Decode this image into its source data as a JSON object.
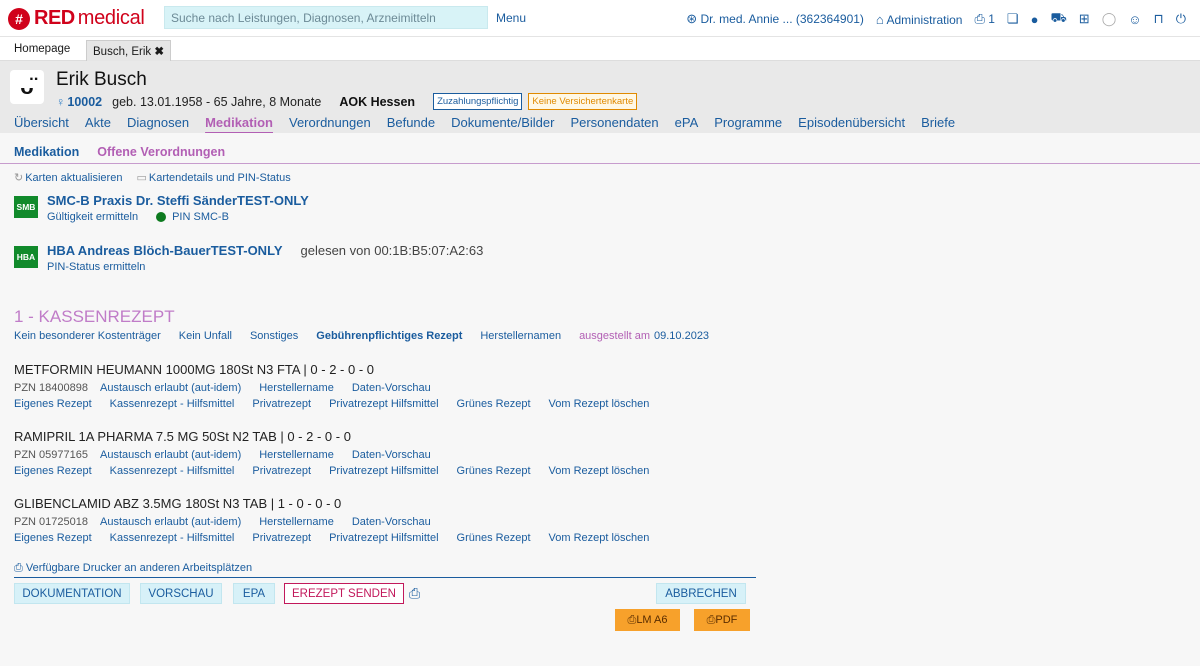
{
  "app": {
    "logo_red": "RED",
    "logo_medical": "medical",
    "logo_badge": "#",
    "search_placeholder": "Suche nach Leistungen, Diagnosen, Arzneimitteln",
    "menu_label": "Menu",
    "user_label": "Dr. med. Annie ... (362364901)",
    "admin_label": "Administration",
    "print_count": "1"
  },
  "window_tabs": [
    {
      "label": "Homepage"
    },
    {
      "label": "Busch, Erik"
    }
  ],
  "patient": {
    "name": "Erik Busch",
    "id": "10002",
    "birth": "geb. 13.01.1958 - 65 Jahre, 8 Monate",
    "insurance": "AOK Hessen",
    "badge_zuzahlung": "Zuzahlungspflichtig",
    "badge_karte": "Keine Versichertenkarte"
  },
  "main_nav": [
    "Übersicht",
    "Akte",
    "Diagnosen",
    "Medikation",
    "Verordnungen",
    "Befunde",
    "Dokumente/Bilder",
    "Personendaten",
    "ePA",
    "Programme",
    "Episodenübersicht",
    "Briefe"
  ],
  "main_nav_active": "Medikation",
  "sub_nav": {
    "item1": "Medikation",
    "item2": "Offene Verordnungen"
  },
  "card_actions": {
    "refresh": "Karten aktualisieren",
    "details": "Kartendetails und PIN-Status"
  },
  "smcb": {
    "icon": "SMB",
    "title": "SMC-B Praxis Dr. Steffi SänderTEST-ONLY",
    "validity": "Gültigkeit ermitteln",
    "pin": "PIN SMC-B"
  },
  "hba": {
    "icon": "HBA",
    "title": "HBA Andreas Blöch-BauerTEST-ONLY",
    "read_from": "gelesen von 00:1B:B5:07:A2:63",
    "pin_status": "PIN-Status ermitteln"
  },
  "rezept": {
    "title": "1 - KASSENREZEPT",
    "info": {
      "kostentraeger": "Kein besonderer Kostenträger",
      "unfall": "Kein Unfall",
      "sonstiges": "Sonstiges",
      "gebuehr": "Gebührenpflichtiges Rezept",
      "hersteller": "Herstellernamen",
      "ausgestellt_label": "ausgestellt am",
      "ausgestellt_date": "09.10.2023"
    }
  },
  "med_actions": {
    "autidem": "Austausch erlaubt (aut-idem)",
    "herstellername": "Herstellername",
    "vorschau": "Daten-Vorschau",
    "eigenes": "Eigenes Rezept",
    "hilfsmittel": "Kassenrezept - Hilfsmittel",
    "privat": "Privatrezept",
    "privat_hilfsmittel": "Privatrezept Hilfsmittel",
    "gruen": "Grünes Rezept",
    "loeschen": "Vom Rezept löschen"
  },
  "medications": [
    {
      "title": "METFORMIN HEUMANN 1000MG 180St N3 FTA | 0 - 2 - 0 - 0",
      "pzn": "PZN 18400898"
    },
    {
      "title": "RAMIPRIL 1A PHARMA 7.5 MG 50St N2 TAB | 0 - 2 - 0 - 0",
      "pzn": "PZN 05977165"
    },
    {
      "title": "GLIBENCLAMID ABZ 3.5MG 180St N3 TAB | 1 - 0 - 0 - 0",
      "pzn": "PZN 01725018"
    }
  ],
  "printers_label": "Verfügbare Drucker an anderen Arbeitsplätzen",
  "buttons": {
    "dokumentation": "DOKUMENTATION",
    "vorschau": "VORSCHAU",
    "epa": "EPA",
    "erezept": "EREZEPT SENDEN",
    "abbrechen": "ABBRECHEN",
    "lm": "LM A6",
    "pdf": "PDF"
  }
}
